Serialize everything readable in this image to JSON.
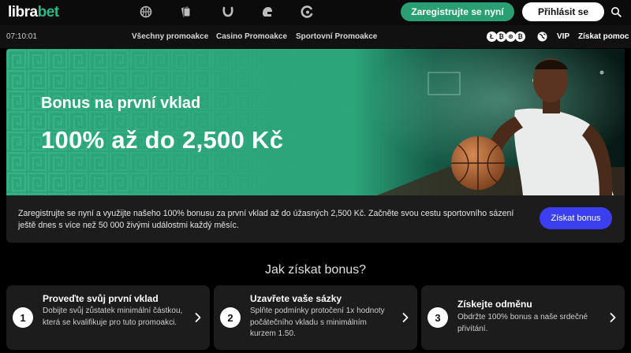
{
  "header": {
    "logo_main": "libra",
    "logo_accent": "bet",
    "sport_icons": [
      "basketball-icon",
      "cards-icon",
      "horseshoe-icon",
      "helmet-icon",
      "swirl-icon"
    ],
    "register_label": "Zaregistrujte se nyní",
    "login_label": "Přihlásit se",
    "search_icon": "search-icon"
  },
  "subnav": {
    "clock": "07:10:01",
    "links": [
      "Všechny promoakce",
      "Casino Promoakce",
      "Sportovní Promoakce"
    ],
    "crypto_icons": [
      "Ł",
      "₿",
      "⊛",
      "₿"
    ],
    "vip": "VIP",
    "help": "Získat pomoc"
  },
  "hero": {
    "title": "Bonus na první vklad",
    "amount": "100% až do 2,500 Kč"
  },
  "info": {
    "text": "Zaregistrujte se nyní a využijte našeho 100% bonusu za první vklad až do úžasných 2,500 Kč. Začněte svou cestu sportovního sázení ještě dnes s více než 50 000 živými událostmi každý měsíc.",
    "button": "Získat bonus"
  },
  "steps": {
    "title": "Jak získat bonus?",
    "items": [
      {
        "num": "1",
        "title": "Proveďte svůj první vklad",
        "desc": "Dobijte svůj zůstatek minimální částkou, která se kvalifikuje pro tuto promoakci."
      },
      {
        "num": "2",
        "title": "Uzavřete vaše sázky",
        "desc": "Splňte podmínky protočení 1x hodnoty počátečního vkladu s minimálním kurzem 1.50."
      },
      {
        "num": "3",
        "title": "Získejte odměnu",
        "desc": "Obdržte 100% bonus a naše srdečné přivítání."
      }
    ]
  },
  "colors": {
    "brand_green": "#2a9f73",
    "hero_green": "#2da57b",
    "cta_blue": "#3b3ff0"
  }
}
